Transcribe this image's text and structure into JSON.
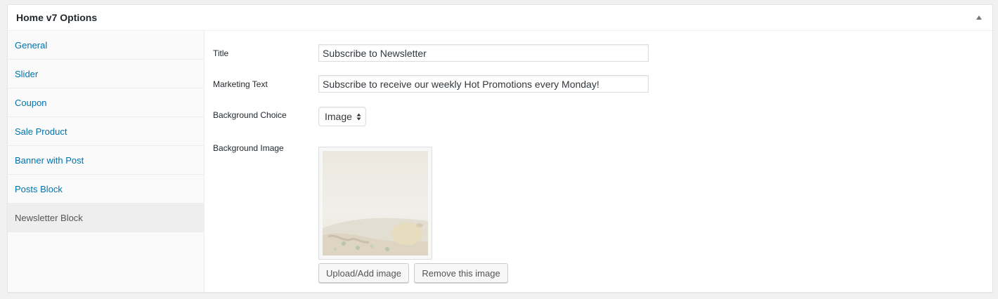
{
  "metabox": {
    "title": "Home v7 Options",
    "toggle_icon": "triangle-up-icon"
  },
  "tabs": [
    {
      "label": "General",
      "active": false
    },
    {
      "label": "Slider",
      "active": false
    },
    {
      "label": "Coupon",
      "active": false
    },
    {
      "label": "Sale Product",
      "active": false
    },
    {
      "label": "Banner with Post",
      "active": false
    },
    {
      "label": "Posts Block",
      "active": false
    },
    {
      "label": "Newsletter Block",
      "active": true
    }
  ],
  "fields": {
    "title_label": "Title",
    "title_value": "Subscribe to Newsletter",
    "marketing_label": "Marketing Text",
    "marketing_value": "Subscribe to receive our weekly Hot Promotions every Monday!",
    "bg_choice_label": "Background Choice",
    "bg_choice_value": "Image",
    "bg_image_label": "Background Image"
  },
  "buttons": {
    "upload": "Upload/Add image",
    "remove": "Remove this image"
  },
  "colors": {
    "link": "#0073aa",
    "active_tab_bg": "#eeeeee"
  }
}
